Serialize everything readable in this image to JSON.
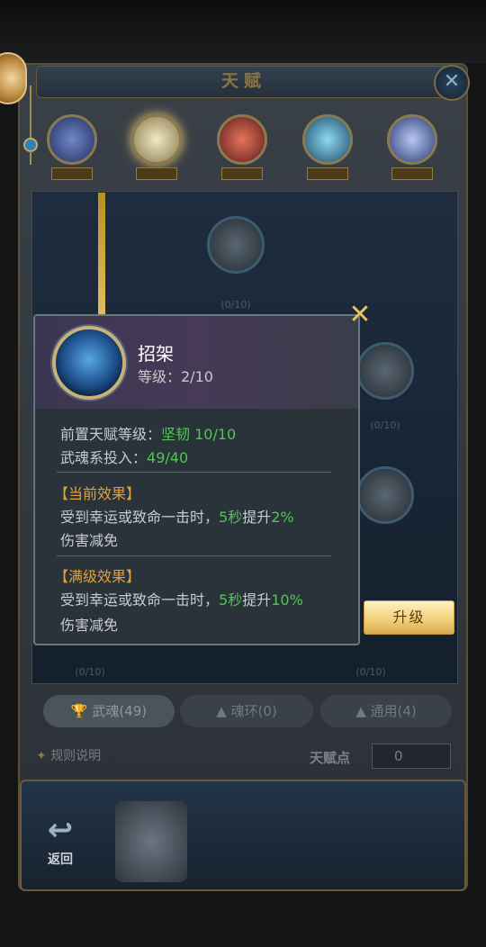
{
  "window": {
    "title": "天赋",
    "close_glyph": "✕"
  },
  "categories": [
    {
      "tag": ""
    },
    {
      "tag": ""
    },
    {
      "tag": ""
    },
    {
      "tag": ""
    },
    {
      "tag": ""
    }
  ],
  "tree": {
    "nodes": [
      {
        "label": "",
        "progress": "(0/10)"
      },
      {
        "label": "",
        "progress": "(0/10)"
      },
      {
        "label": "",
        "progress": ""
      },
      {
        "label": "",
        "progress": ""
      },
      {
        "label": "",
        "progress": "(0/10)"
      },
      {
        "label": "",
        "progress": "(0/10)"
      }
    ]
  },
  "bottom_tabs": [
    {
      "label": "武魂(49)",
      "active": true
    },
    {
      "label": "魂环(0)",
      "active": false
    },
    {
      "label": "通用(4)",
      "active": false
    }
  ],
  "rules_label": "规则说明",
  "talent_points": {
    "label": "天赋点",
    "value": "0"
  },
  "footer": {
    "back_label": "返回"
  },
  "tooltip": {
    "name": "招架",
    "level_text": "等级：2/10",
    "prereq_label": "前置天赋等级：",
    "prereq_value": "坚韧 10/10",
    "invest_label": "武魂系投入：",
    "invest_value": "49/40",
    "current_title": "【当前效果】",
    "current_line1_a": "受到幸运或致命一击时，",
    "current_line1_b": "5秒",
    "current_line1_c": "提升",
    "current_line1_d": "2%",
    "current_line2": "伤害减免",
    "max_title": "【满级效果】",
    "max_line1_a": "受到幸运或致命一击时，",
    "max_line1_b": "5秒",
    "max_line1_c": "提升",
    "max_line1_d": "10%",
    "max_line2": "伤害减免",
    "close_glyph": "✕"
  },
  "upgrade_label": "升级",
  "colors": {
    "accent_gold": "#e0a23c",
    "value_green": "#4ec94f",
    "upgrade_bg": "#f0cf78"
  }
}
